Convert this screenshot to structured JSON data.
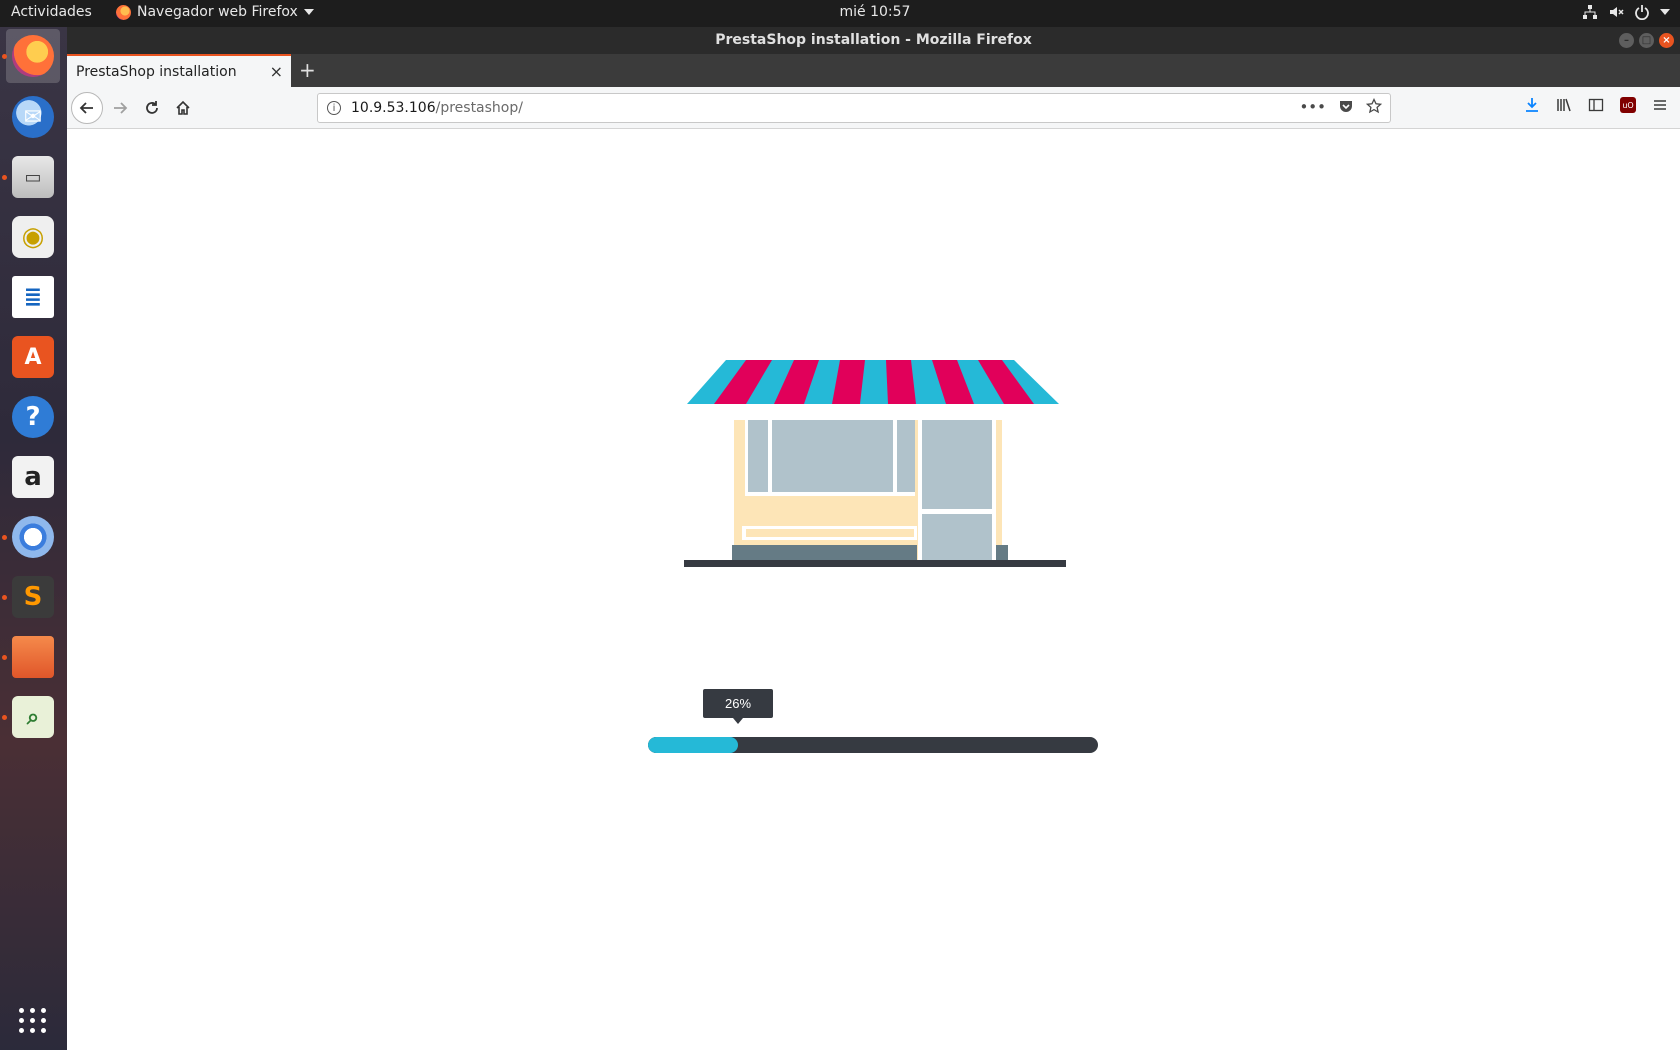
{
  "topbar": {
    "activities": "Actividades",
    "app_menu": "Navegador web Firefox",
    "clock": "mié 10:57"
  },
  "dock": {
    "items": [
      {
        "name": "firefox",
        "active": true,
        "running": true
      },
      {
        "name": "thunderbird",
        "active": false,
        "running": false
      },
      {
        "name": "file-cabinet",
        "active": false,
        "running": true
      },
      {
        "name": "rhythmbox",
        "active": false,
        "running": false
      },
      {
        "name": "libreoffice-writer",
        "active": false,
        "running": false
      },
      {
        "name": "software-center",
        "active": false,
        "running": false
      },
      {
        "name": "help",
        "active": false,
        "running": false
      },
      {
        "name": "amazon",
        "active": false,
        "running": false
      },
      {
        "name": "chromium",
        "active": false,
        "running": true
      },
      {
        "name": "sublime-text",
        "active": false,
        "running": true
      },
      {
        "name": "files",
        "active": false,
        "running": true
      },
      {
        "name": "system-monitor",
        "active": false,
        "running": true
      }
    ]
  },
  "window": {
    "title": "PrestaShop installation - Mozilla Firefox"
  },
  "tab": {
    "label": "PrestaShop installation",
    "close": "×",
    "new_tab": "+"
  },
  "urlbar": {
    "host": "10.9.53.106",
    "path": "/prestashop/",
    "more": "•••"
  },
  "install": {
    "progress_label": "26%",
    "progress_fraction": 0.2,
    "colors": {
      "accent": "#25b9d7",
      "track": "#363a41",
      "awning_stripe": "#e1005a",
      "shop_wall": "#fde5b7",
      "glass": "#b0c2cb"
    }
  }
}
